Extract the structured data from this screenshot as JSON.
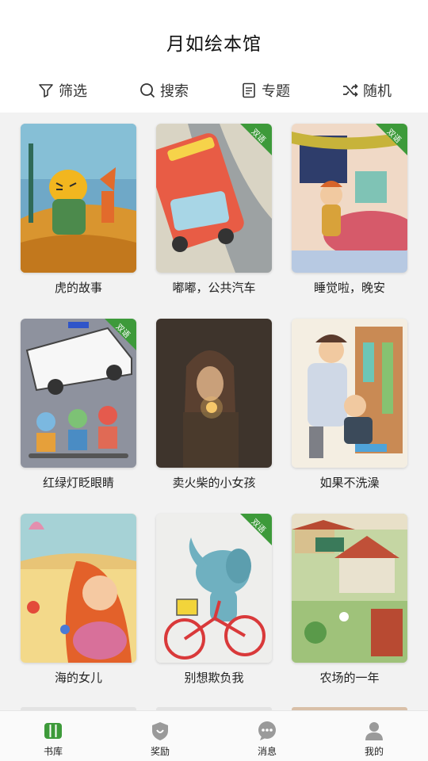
{
  "app": {
    "title": "月如绘本馆"
  },
  "toolbar": [
    {
      "label": "筛选",
      "icon": "filter-icon"
    },
    {
      "label": "搜索",
      "icon": "search-icon"
    },
    {
      "label": "专题",
      "icon": "document-icon"
    },
    {
      "label": "随机",
      "icon": "shuffle-icon"
    }
  ],
  "badge_label": "双语",
  "books": [
    {
      "title": "虎的故事",
      "bilingual": false
    },
    {
      "title": "嘟嘟，公共汽车",
      "bilingual": true
    },
    {
      "title": "睡觉啦，晚安",
      "bilingual": true
    },
    {
      "title": "红绿灯眨眼睛",
      "bilingual": true
    },
    {
      "title": "卖火柴的小女孩",
      "bilingual": false
    },
    {
      "title": "如果不洗澡",
      "bilingual": false
    },
    {
      "title": "海的女儿",
      "bilingual": false
    },
    {
      "title": "别想欺负我",
      "bilingual": true
    },
    {
      "title": "农场的一年",
      "bilingual": false
    }
  ],
  "tabs": [
    {
      "label": "书库",
      "icon": "library-icon",
      "active": true
    },
    {
      "label": "奖励",
      "icon": "reward-shield-icon",
      "active": false
    },
    {
      "label": "消息",
      "icon": "message-icon",
      "active": false
    },
    {
      "label": "我的",
      "icon": "profile-icon",
      "active": false
    }
  ],
  "colors": {
    "accent": "#3d9a3a",
    "tab_inactive": "#9a9a9a",
    "background": "#f2f2f2"
  }
}
